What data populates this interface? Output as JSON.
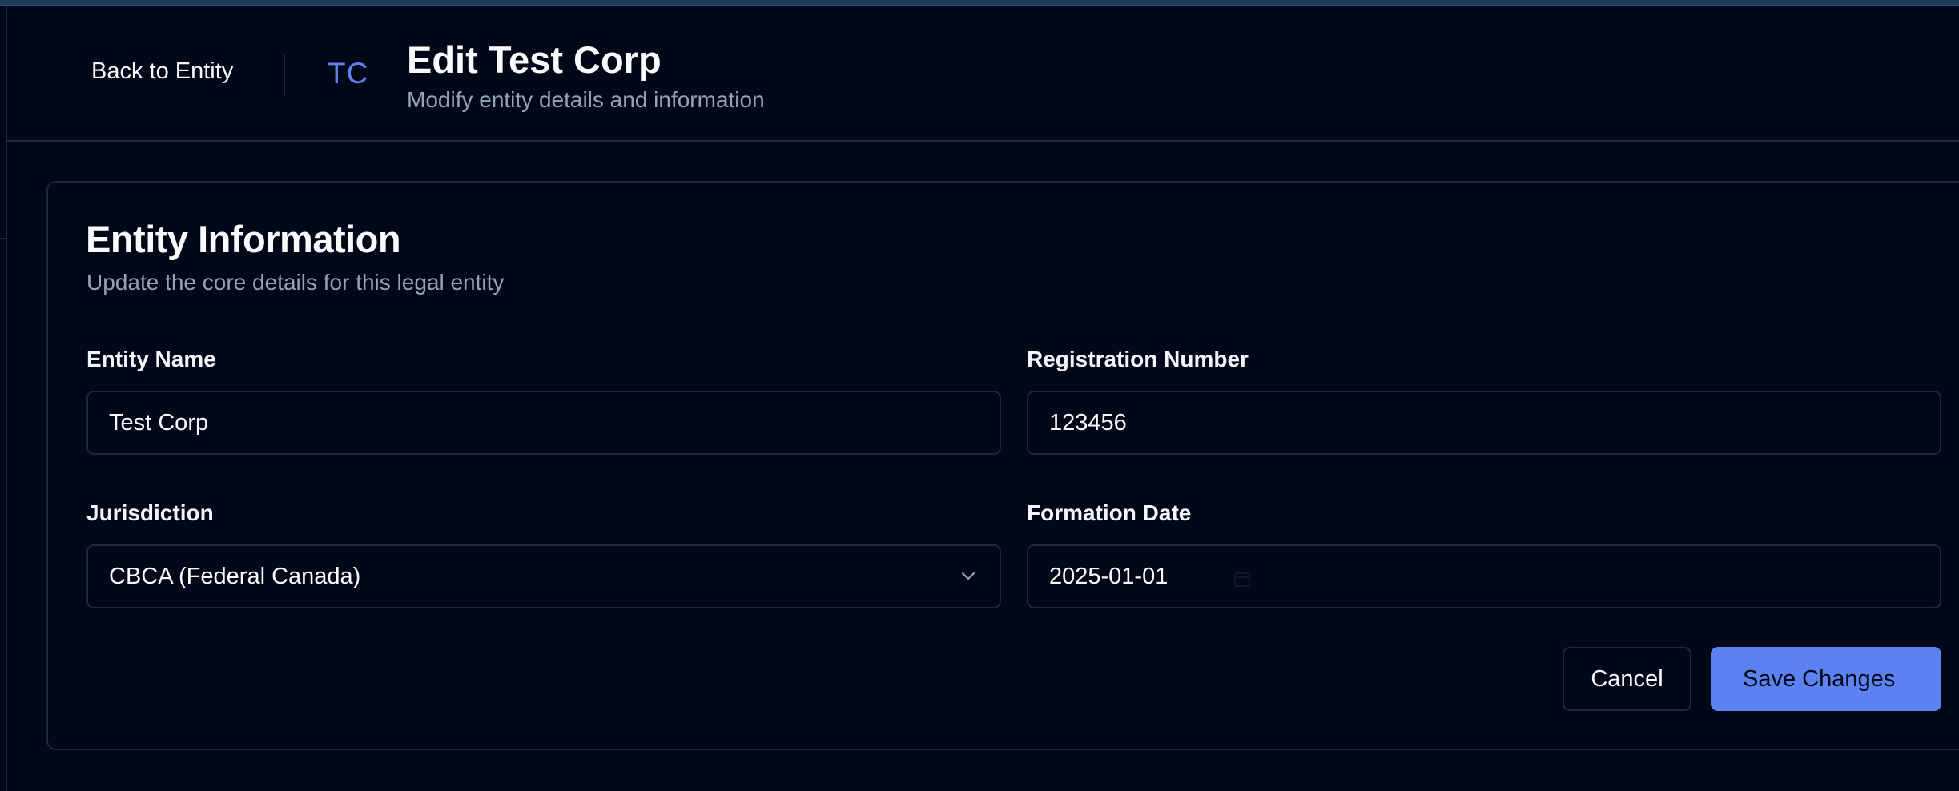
{
  "header": {
    "back_label": "Back to Entity",
    "avatar_initials": "TC",
    "title": "Edit Test Corp",
    "subtitle": "Modify entity details and information"
  },
  "card": {
    "title": "Entity Information",
    "subtitle": "Update the core details for this legal entity"
  },
  "form": {
    "entity_name": {
      "label": "Entity Name",
      "value": "Test Corp"
    },
    "registration_number": {
      "label": "Registration Number",
      "value": "123456"
    },
    "jurisdiction": {
      "label": "Jurisdiction",
      "value": "CBCA (Federal Canada)"
    },
    "formation_date": {
      "label": "Formation Date",
      "value": "2025-01-01"
    }
  },
  "actions": {
    "cancel_label": "Cancel",
    "save_label": "Save Changes"
  },
  "colors": {
    "background": "#020817",
    "border": "#1e293b",
    "accent": "#5b82f0",
    "muted_text": "#94a3b8"
  },
  "icons": {
    "select_chevron": "chevron-down-icon",
    "date_picker": "calendar-icon"
  }
}
